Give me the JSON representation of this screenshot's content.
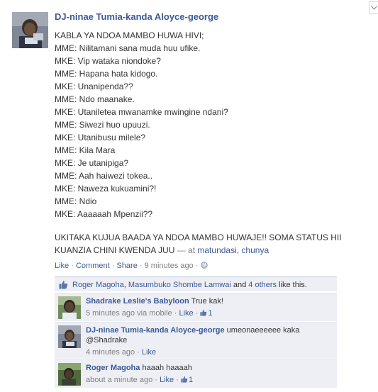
{
  "post": {
    "author": "DJ-ninae Tumia-kanda Aloyce-george",
    "lines": [
      "KABLA YA NDOA MAMBO HUWA HIVI;",
      "MME: Nilitamani sana muda huu ufike.",
      "MKE: Vip wataka niondoke?",
      "MME: Hapana hata kidogo.",
      "MKE: Unanipenda??",
      "MME: Ndo maanake.",
      "MKE: Utaniletea mwanamke mwingine ndani?",
      "MME: Siwezi huo upuuzi.",
      "MKE: Utanibusu milele?",
      "MME: Kila Mara",
      "MKE: Je utanipiga?",
      "MME: Aah haiwezi tokea..",
      "MKE: Naweza kukuamini?!",
      "MME: Ndio",
      "MKE: Aaaaaah Mpenzii??"
    ],
    "closing": "UKITAKA KUJUA BAADA YA NDOA MAMBO HUWAJE!! SOMA STATUS HII KUANZIA CHINI KWENDA JUU",
    "location_prefix": "— at",
    "location": "matundasi, chunya",
    "actions": {
      "like": "Like",
      "comment": "Comment",
      "share": "Share",
      "time": "9 minutes ago"
    }
  },
  "likes": {
    "name1": "Roger Magoha",
    "name2": "Masumbuko Shombe Lamwai",
    "connector": "and",
    "others": "4 others",
    "suffix": "like this."
  },
  "comments": [
    {
      "author": "Shadrake Leslie's Babyloon",
      "text": "True kak!",
      "time": "5 minutes ago via mobile",
      "like": "Like",
      "like_count": "1"
    },
    {
      "author": "DJ-ninae Tumia-kanda Aloyce-george",
      "text": "umeonaeeeeee kaka @Shadrake",
      "time": "4 minutes ago",
      "like": "Like"
    },
    {
      "author": "Roger Magoha",
      "text": "haaah haaaah",
      "time": "about a minute ago",
      "like": "Like",
      "like_count": "1"
    }
  ],
  "colors": {
    "link": "#3b5998",
    "meta": "#808080",
    "ufi_background": "#edeff4"
  },
  "icons": [
    "chevron-down-icon",
    "globe-icon",
    "thumbs-up-icon"
  ]
}
